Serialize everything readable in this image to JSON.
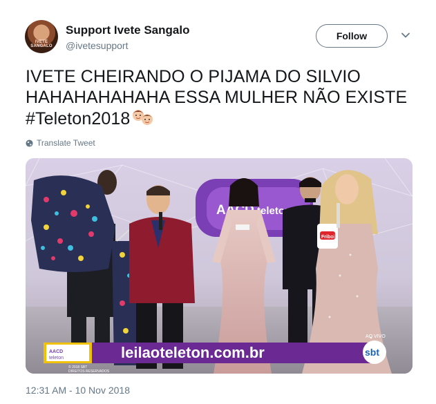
{
  "author": {
    "display_name": "Support Ivete Sangalo",
    "handle": "@ivetesupport",
    "avatar_caption": "IVETE SANGALO"
  },
  "actions": {
    "follow_label": "Follow",
    "more_icon": "chevron-down-icon"
  },
  "tweet": {
    "line1": "IVETE CHEIRANDO O PIJAMA DO SILVIO",
    "line2": "HAHAHAHAHAHA ESSA MULHER NÃO EXISTE",
    "line3": "#Teleton2018",
    "emoji": "two-faces-emoji"
  },
  "translate": {
    "label": "Translate Tweet",
    "icon": "globe-icon"
  },
  "media": {
    "stage_logo": "AACD",
    "stage_logo_suffix": "teleton",
    "lower_third_logo": "AACD",
    "lower_third_logo_sub": "teleton",
    "lower_third_url": "leilaoteleton.com.br",
    "live_label": "AO VIVO",
    "channel_logo": "sbt",
    "sponsor_label": "Friboi",
    "small_print": "© 2018 SBT",
    "small_print_2": "DIREITOS RESERVADOS"
  },
  "timestamp": "12:31 AM - 10 Nov 2018",
  "colors": {
    "text": "#14171a",
    "secondary": "#657786",
    "stage_purple": "#7a3fb5",
    "lower_third_purple": "#6b2a93",
    "lower_third_yellow": "#f2c200"
  }
}
